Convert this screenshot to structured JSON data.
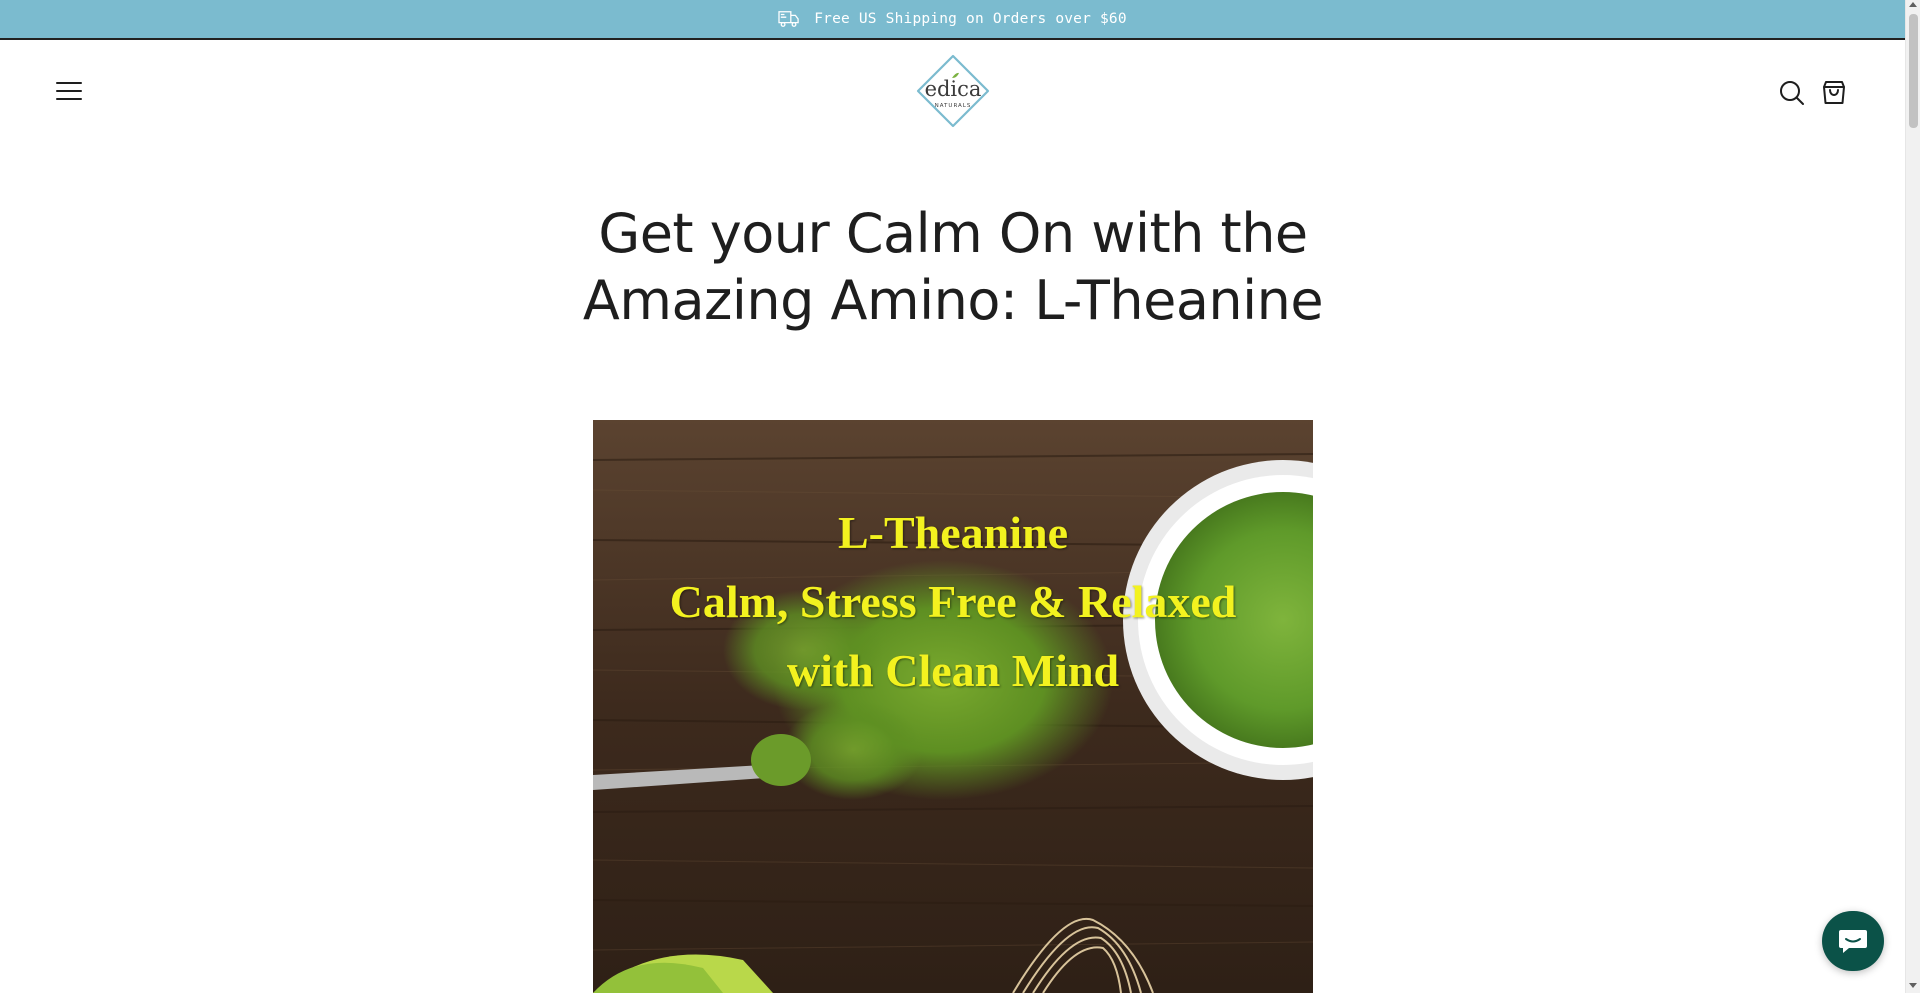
{
  "announcement": {
    "text": "Free US Shipping on Orders over $60",
    "icon": "truck-icon"
  },
  "header": {
    "logo_text": "edica",
    "logo_subtext": "NATURALS",
    "menu_icon": "hamburger-menu-icon",
    "search_icon": "search-icon",
    "cart_icon": "shopping-bag-icon"
  },
  "article": {
    "title": "Get your Calm On with the Amazing Amino: L-Theanine",
    "hero_caption_lines": [
      "L-Theanine",
      "Calm, Stress Free & Relaxed",
      "with Clean Mind"
    ]
  },
  "chat": {
    "icon": "chat-bubble-icon"
  },
  "colors": {
    "announcement_bg": "#7bbbcf",
    "caption": "#f3f21f",
    "text": "#1e1e1e",
    "chat_bg": "#0b5248"
  }
}
